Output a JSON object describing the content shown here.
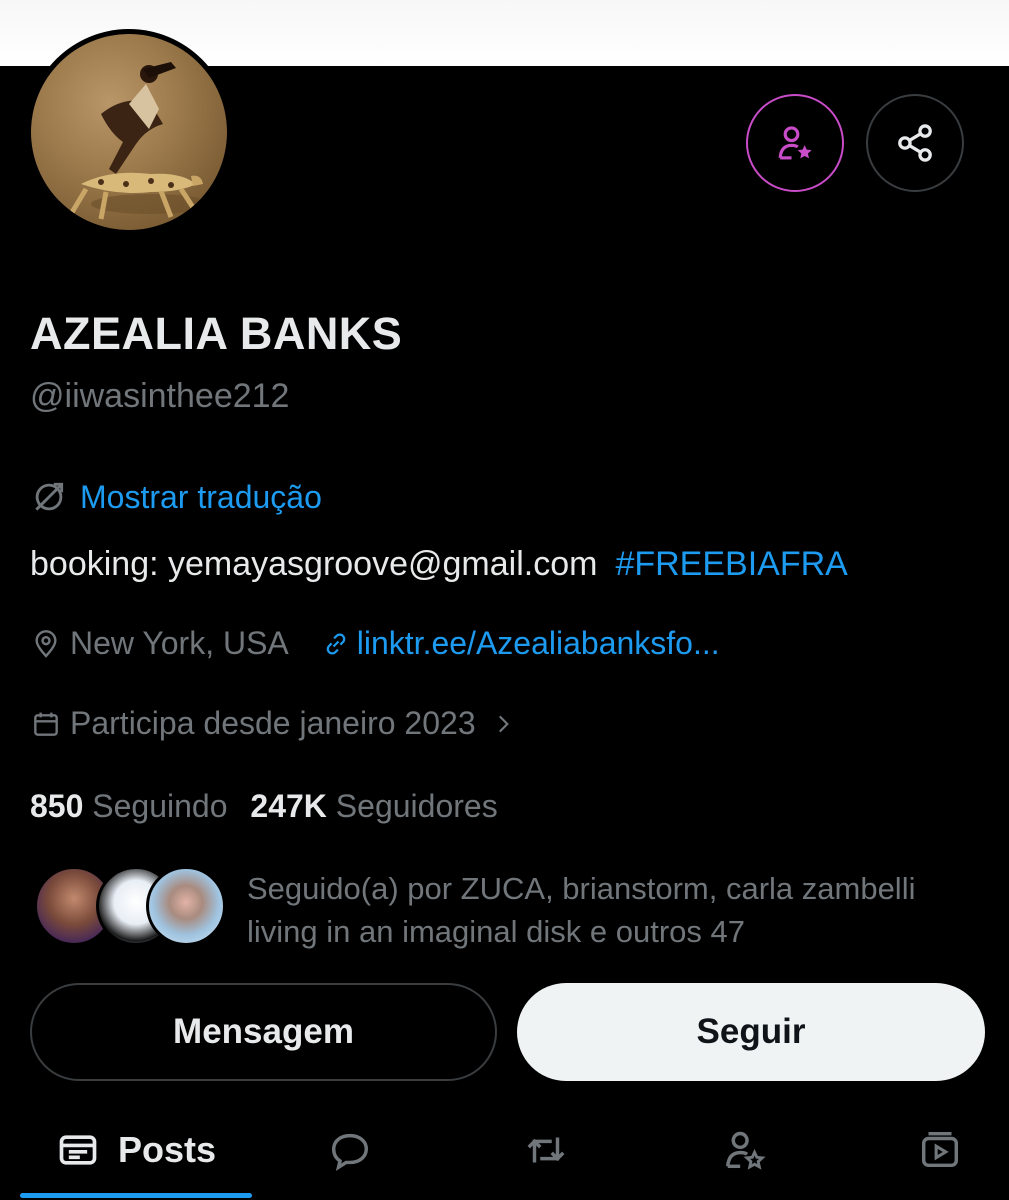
{
  "profile": {
    "display_name": "AZEALIA BANKS",
    "handle": "@iiwasinthee212",
    "translate_label": "Mostrar tradução",
    "bio_text": "booking: yemayasgroove@gmail.com",
    "bio_hashtag": "#FREEBIAFRA",
    "location": "New York, USA",
    "website": "linktr.ee/Azealiabanksfo...",
    "joined": "Participa desde janeiro 2023"
  },
  "stats": {
    "following_count": "850",
    "following_label": "Seguindo",
    "followers_count": "247K",
    "followers_label": "Seguidores"
  },
  "followed_by": {
    "text": "Seguido(a) por ZUCA, brianstorm, carla zambelli living in an imaginal disk e outros 47"
  },
  "actions": {
    "message_label": "Mensagem",
    "follow_label": "Seguir"
  },
  "tabs": {
    "posts_label": "Posts"
  },
  "colors": {
    "background": "#000000",
    "link_blue": "#1d9bf0",
    "subscribe_accent": "#c94cc8",
    "muted_text": "#71767b"
  },
  "icons": [
    "subscribe-icon",
    "share-icon",
    "translate-icon",
    "location-icon",
    "link-icon",
    "calendar-icon",
    "chevron-right-icon",
    "posts-icon",
    "replies-icon",
    "reposts-icon",
    "subscriptions-icon",
    "media-icon"
  ]
}
